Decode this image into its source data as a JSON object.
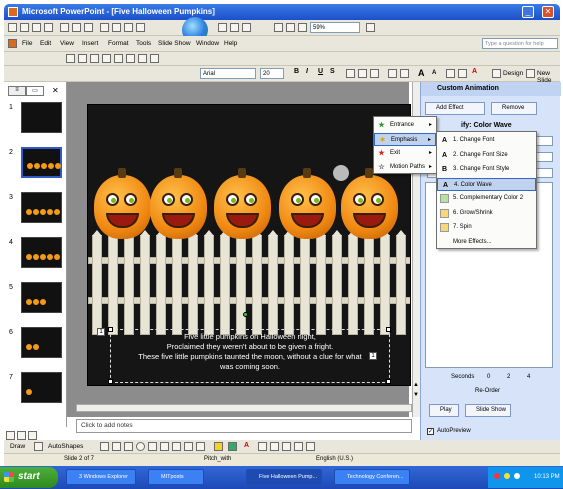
{
  "window": {
    "title": "Microsoft PowerPoint - [Five Halloween Pumpkins]"
  },
  "menu": {
    "items": [
      "File",
      "Edit",
      "View",
      "Insert",
      "Format",
      "Tools",
      "Slide Show",
      "Window",
      "Help"
    ],
    "help_placeholder": "Type a question for help"
  },
  "format_toolbar": {
    "font": "Arial",
    "size": "20",
    "zoom": "59%",
    "design_label": "Design",
    "new_slide_label": "New Slide"
  },
  "slides_pane": {
    "tabs": [
      "Outline",
      "Slides"
    ],
    "numbers": [
      "1",
      "2",
      "3",
      "4",
      "5",
      "6",
      "7"
    ],
    "selected": "2"
  },
  "slide": {
    "poem": [
      "Five little pumpkins on Halloween night,",
      "Proclaimed they weren't about to be given a fright.",
      "These five little pumpkins taunted the moon, without a clue for what",
      "was coming soon."
    ],
    "tag_left": "1",
    "tag_right": "1"
  },
  "notes": {
    "placeholder": "Click to add notes"
  },
  "menus": {
    "effect_types": [
      {
        "label": "Entrance",
        "icon": "star-entrance-icon"
      },
      {
        "label": "Emphasis",
        "icon": "star-emphasis-icon"
      },
      {
        "label": "Exit",
        "icon": "star-exit-icon"
      },
      {
        "label": "Motion Paths",
        "icon": "motion-path-icon"
      }
    ],
    "emphasis_options": [
      {
        "label": "1. Change Font",
        "icon": "A"
      },
      {
        "label": "2. Change Font Size",
        "icon": "A"
      },
      {
        "label": "3. Change Font Style",
        "icon": "B"
      },
      {
        "label": "4. Color Wave",
        "icon": "A"
      },
      {
        "label": "5. Complementary Color 2",
        "icon": ""
      },
      {
        "label": "6. Grow/Shrink",
        "icon": ""
      },
      {
        "label": "7. Spin",
        "icon": ""
      },
      {
        "label": "More Effects...",
        "icon": ""
      }
    ],
    "highlighted_type": "Emphasis",
    "highlighted_option": "4. Color Wave"
  },
  "task_pane": {
    "title": "Custom Animation",
    "add_effect": "Add Effect",
    "remove": "Remove",
    "modify": "ify: Color Wave",
    "seconds": "Seconds",
    "timeline": [
      "0",
      "2",
      "4"
    ],
    "reorder": "Re-Order",
    "play": "Play",
    "slide_show": "Slide Show",
    "autopreview": "AutoPreview"
  },
  "drawing_toolbar": {
    "draw": "Draw",
    "autoshapes": "AutoShapes"
  },
  "status_bar": {
    "slide_of": "Slide 2 of 7",
    "design": "Pitch_with",
    "language": "English (U.S.)"
  },
  "taskbar": {
    "start": "start",
    "tasks": [
      "3 Windows Explorer",
      "MITposts",
      "Five Halloween Pump...",
      "Technology Conferen..."
    ],
    "clock": "10:13 PM"
  },
  "colors": {
    "title_bar": "#1c4fc9",
    "task_pane": "#d6e3f8",
    "pumpkin": "#f08812",
    "highlight": "#c1d2ee"
  }
}
